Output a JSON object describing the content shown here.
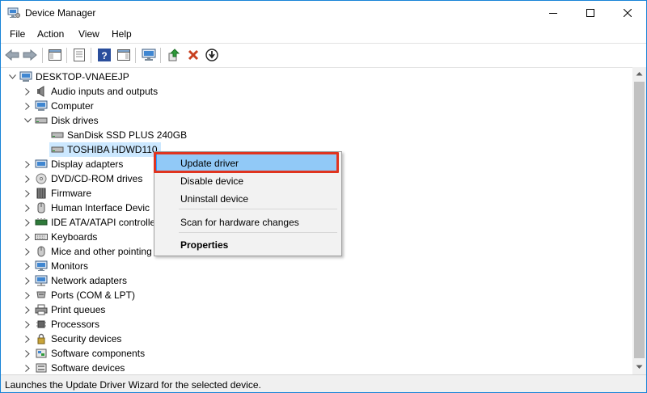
{
  "window": {
    "title": "Device Manager",
    "icon": "device-manager-icon"
  },
  "menu": [
    "File",
    "Action",
    "View",
    "Help"
  ],
  "toolbar": {
    "icons": [
      "back-arrow-icon",
      "forward-arrow-icon",
      "show-hide-tree-icon",
      "properties-icon",
      "help-icon",
      "action-pane-icon",
      "monitor-icon",
      "update-driver-icon",
      "uninstall-icon",
      "scan-icon"
    ]
  },
  "tree": {
    "root": "DESKTOP-VNAEEJP",
    "items": [
      {
        "label": "Audio inputs and outputs",
        "icon": "speaker-icon"
      },
      {
        "label": "Computer",
        "icon": "computer-icon"
      },
      {
        "label": "Disk drives",
        "icon": "disk-drive-icon",
        "expanded": true,
        "children": [
          "SanDisk SSD PLUS 240GB",
          "TOSHIBA HDWD110"
        ]
      },
      {
        "label": "Display adapters",
        "icon": "display-adapter-icon"
      },
      {
        "label": "DVD/CD-ROM drives",
        "icon": "dvd-icon"
      },
      {
        "label": "Firmware",
        "icon": "firmware-icon"
      },
      {
        "label": "Human Interface Devic",
        "icon": "hid-icon"
      },
      {
        "label": "IDE ATA/ATAPI controlle",
        "icon": "ide-controller-icon"
      },
      {
        "label": "Keyboards",
        "icon": "keyboard-icon"
      },
      {
        "label": "Mice and other pointing",
        "icon": "mouse-icon"
      },
      {
        "label": "Monitors",
        "icon": "monitor-icon"
      },
      {
        "label": "Network adapters",
        "icon": "network-adapter-icon"
      },
      {
        "label": "Ports (COM & LPT)",
        "icon": "port-icon"
      },
      {
        "label": "Print queues",
        "icon": "printer-icon"
      },
      {
        "label": "Processors",
        "icon": "processor-icon"
      },
      {
        "label": "Security devices",
        "icon": "security-icon"
      },
      {
        "label": "Software components",
        "icon": "software-component-icon"
      },
      {
        "label": "Software devices",
        "icon": "software-device-icon"
      }
    ]
  },
  "context_menu": {
    "items": [
      "Update driver",
      "Disable device",
      "Uninstall device",
      "Scan for hardware changes",
      "Properties"
    ],
    "highlighted": "Update driver"
  },
  "status": "Launches the Update Driver Wizard for the selected device.",
  "colors": {
    "selection": "#cce8ff",
    "menu_highlight": "#91c9f7",
    "callout": "#e0341f",
    "window_border": "#1883d7"
  }
}
